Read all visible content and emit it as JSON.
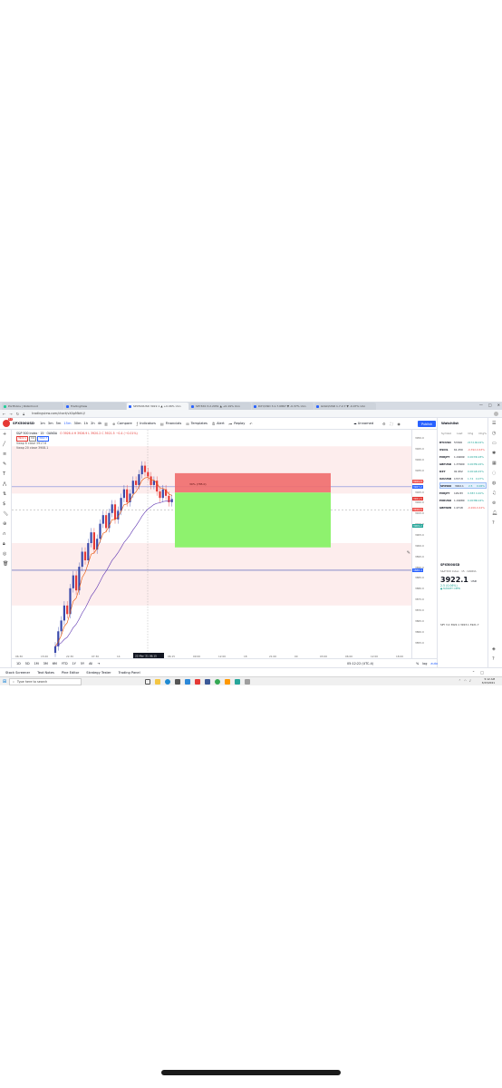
{
  "browser": {
    "tabs": [
      "Portfolios | Robinhood",
      "TradingView",
      "SPX500USD 3922.1 ▲ +0.06% Unn",
      "SPY3X0 3.2.2051 ▲ +0.19% Unn",
      "DXY/USD 3.1.7.0867 ▼ -0.37% Unn",
      "GOLD/USD 1.7.2.7 ▼ -0.07% Unn"
    ],
    "window_controls": [
      "—",
      "□",
      "✕"
    ],
    "url": "tradingview.com/chart/vX4pMbhU/"
  },
  "toolbar": {
    "logo_badge": "11",
    "symbol": "SPX500USD",
    "timeframes": [
      "1m",
      "3m",
      "5m",
      "15m",
      "30m",
      "1h",
      "2h",
      "4h"
    ],
    "active_timeframe": "15m",
    "compare": "Compare",
    "indicators": "Indicators",
    "financials": "Financials",
    "templates": "Templates",
    "alert": "Alert",
    "replay": "Replay",
    "layout_name": "Unnamed",
    "publish": "Publish"
  },
  "legend": {
    "symbol_line": "S&P 500 Index · 15 · OANDA",
    "ohlc": "O 3926.4  H 3926.9  L 3920.2  C 3921.5  −0.4 (−0.01%)",
    "price_box_1": "3922.1",
    "price_box_2": "0.6",
    "price_box_3": "3922.7",
    "ema1": "Vwap 6 close  3917.6",
    "ema2": "Vwap 20 close  3908.1"
  },
  "chart_data": {
    "type": "candlestick",
    "symbol": "SPX500USD",
    "interval": "15",
    "xlabels": [
      "06:30",
      "15:00",
      "22:30",
      "07:30",
      "14",
      "22 Mar '21",
      "06:15",
      "09:00",
      "12:00",
      "18",
      "21:00",
      "00",
      "03:00",
      "06:00",
      "12:00",
      "18:00"
    ],
    "ylim": [
      3850,
      3952
    ],
    "last_price": 3921.5,
    "target_label": "30% (785.0)",
    "ema_fast_last": 3917.6,
    "ema_slow_last": 3908.1
  },
  "price_axis": {
    "labels": [
      "3950.0",
      "3945.0",
      "3940.0",
      "3935.0",
      "3930.0",
      "3925.0",
      "3920.0",
      "3915.0",
      "3910.0",
      "3905.0",
      "3900.0",
      "3895.0",
      "3890.0",
      "3885.0",
      "3880.0",
      "3875.0",
      "3870.0",
      "3865.0",
      "3860.0",
      "3855.0"
    ],
    "tags": [
      {
        "text": "3929.8",
        "color": "#ef5350"
      },
      {
        "text": "3927.2",
        "color": "#2962ff"
      },
      {
        "text": "3921.5",
        "color": "#e53935"
      },
      {
        "text": "3916.5",
        "color": "#ef5350"
      },
      {
        "text": "3909.2",
        "color": "#26a69a"
      },
      {
        "text": "3888.4",
        "color": "#2962ff"
      }
    ]
  },
  "watchlist": {
    "title": "Watchlist",
    "columns": [
      "Symbol",
      "Last",
      "Chg",
      "Chg%"
    ],
    "rows": [
      {
        "symbol": "BTCUSD",
        "last": "57499",
        "chg": "2172.6",
        "pct": "4.02%",
        "dir": "up"
      },
      {
        "symbol": "USOIL",
        "last": "61.250",
        "chg": "-0.392",
        "pct": "-0.63%",
        "dir": "dn"
      },
      {
        "symbol": "EURJPY",
        "last": "1.19699",
        "chg": "0.0033",
        "pct": "0.28%",
        "dir": "up"
      },
      {
        "symbol": "GBPUSD",
        "last": "1.37900",
        "chg": "0.0035",
        "pct": "0.26%",
        "dir": "up"
      },
      {
        "symbol": "DXY",
        "last": "91.952",
        "chg": "0.0012",
        "pct": "0.45%",
        "dir": "up"
      },
      {
        "symbol": "XAUUSD",
        "last": "1727.8",
        "chg": "1.74",
        "pct": "0.07%",
        "dir": "up"
      },
      {
        "symbol": "SPX500",
        "last": "3922.1",
        "chg": "2.5",
        "pct": "0.06%",
        "dir": "up"
      },
      {
        "symbol": "EURJPY",
        "last": "129.83",
        "chg": "0.383",
        "pct": "0.40%",
        "dir": "up"
      },
      {
        "symbol": "EURUSD",
        "last": "1.19080",
        "chg": "0.0038",
        "pct": "0.04%",
        "dir": "up"
      },
      {
        "symbol": "GBPNZD",
        "last": "1.9718",
        "chg": "-0.206",
        "pct": "-0.42%",
        "dir": "dn"
      }
    ],
    "detail": {
      "symbol": "SPX500USD",
      "name": "S&P 500 Index · 15 · OANDA",
      "price": "3922.1",
      "unit": "USD",
      "change": "2.5 (0.06%)",
      "status": "● MARKET OPEN"
    },
    "bottom_row": "SPY 3.2  3922.1  3923.1  3921.7"
  },
  "range_bar": {
    "items": [
      "1D",
      "5D",
      "1M",
      "3M",
      "6M",
      "YTD",
      "1Y",
      "5Y",
      "All"
    ],
    "time": "05:12:22 (UTC-4)",
    "pct": "%",
    "log": "log",
    "auto": "auto"
  },
  "bottom_tabs": [
    "Stock Screener",
    "Text Notes",
    "Pine Editor",
    "Strategy Tester",
    "Trading Panel"
  ],
  "taskbar": {
    "search_placeholder": "Type here to search",
    "time": "5:12 AM",
    "date": "3/23/2021"
  }
}
